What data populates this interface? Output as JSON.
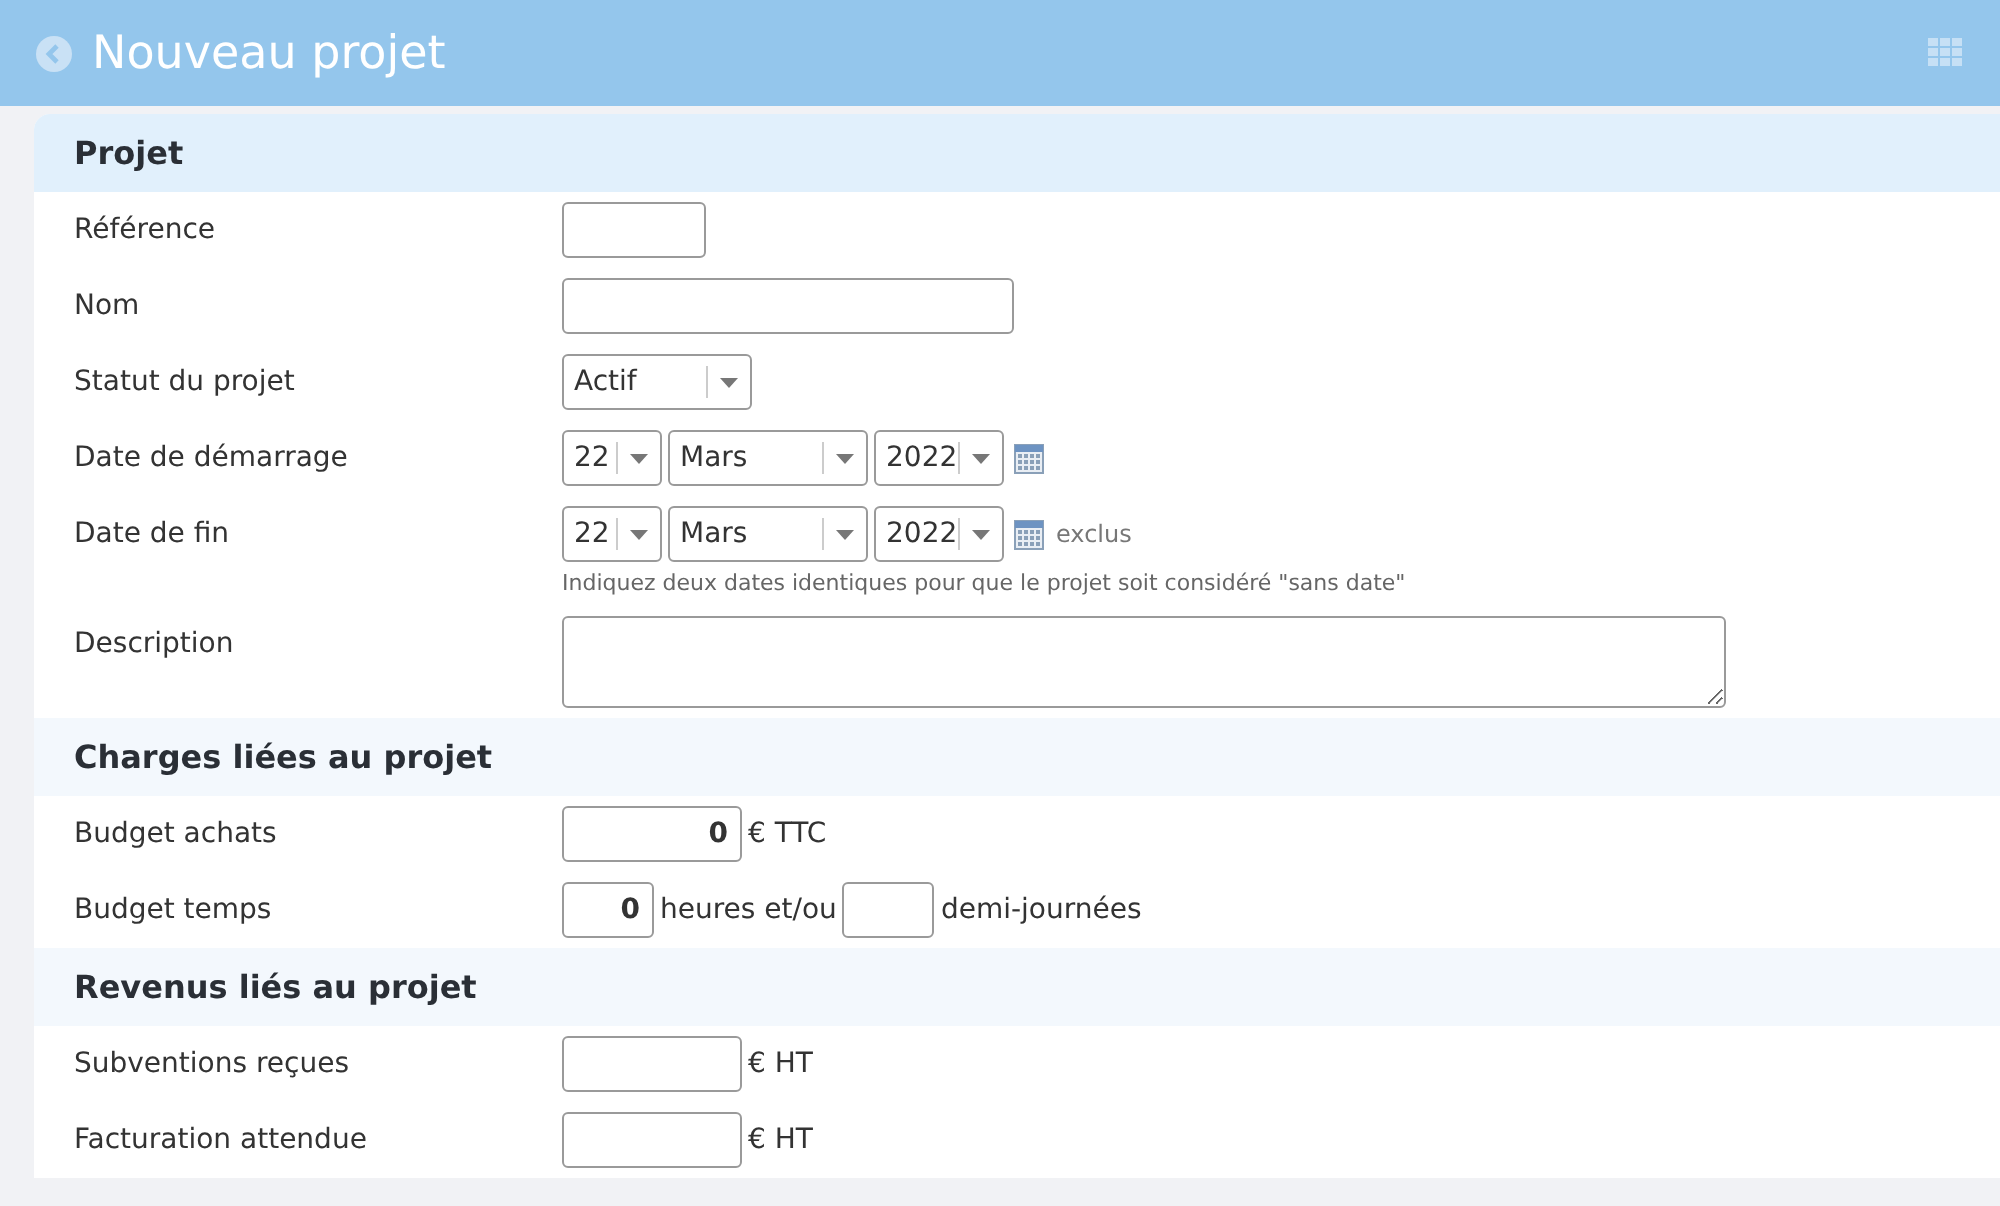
{
  "header": {
    "title": "Nouveau projet"
  },
  "sections": [
    {
      "title": "Projet",
      "rows": [
        {
          "label": "Référence",
          "controls": [
            {
              "kind": "code"
            }
          ]
        },
        {
          "label": "Nom",
          "controls": [
            {
              "kind": "name"
            }
          ]
        },
        {
          "label": "Statut du projet",
          "controls": [
            {
              "kind": "status",
              "value": "Actif"
            }
          ]
        },
        {
          "label": "Date de démarrage",
          "controls": [
            {
              "kind": "day",
              "value": "22"
            },
            {
              "kind": "month",
              "value": "Mars"
            },
            {
              "kind": "year",
              "value": "2022"
            },
            {
              "kind": "calendar"
            }
          ]
        },
        {
          "label": "Date de fin",
          "controls": [
            {
              "kind": "day",
              "value": "22"
            },
            {
              "kind": "month",
              "value": "Mars"
            },
            {
              "kind": "year",
              "value": "2022"
            },
            {
              "kind": "calendar"
            },
            {
              "kind": "note",
              "text": "exclus"
            }
          ],
          "hint": "Indiquez deux dates identiques pour que le projet soit considéré \"sans date\""
        },
        {
          "label": "Description",
          "controls": [
            {
              "kind": "textarea"
            }
          ]
        }
      ]
    },
    {
      "title": "Charges liées au projet",
      "rows": [
        {
          "label": "Budget achats",
          "controls": [
            {
              "kind": "amount",
              "value": "0"
            },
            {
              "kind": "unit",
              "text": "€ TTC"
            }
          ]
        },
        {
          "label": "Budget temps",
          "controls": [
            {
              "kind": "count",
              "value": "0"
            },
            {
              "kind": "unit",
              "text": "heures et/ou"
            },
            {
              "kind": "count"
            },
            {
              "kind": "unit",
              "text": "demi-journées"
            }
          ]
        }
      ]
    },
    {
      "title": "Revenus liés au projet",
      "rows": [
        {
          "label": "Subventions reçues",
          "controls": [
            {
              "kind": "amount"
            },
            {
              "kind": "unit",
              "text": "€ HT"
            }
          ]
        },
        {
          "label": "Facturation attendue",
          "controls": [
            {
              "kind": "amount"
            },
            {
              "kind": "unit",
              "text": "€ HT"
            }
          ]
        }
      ]
    }
  ]
}
